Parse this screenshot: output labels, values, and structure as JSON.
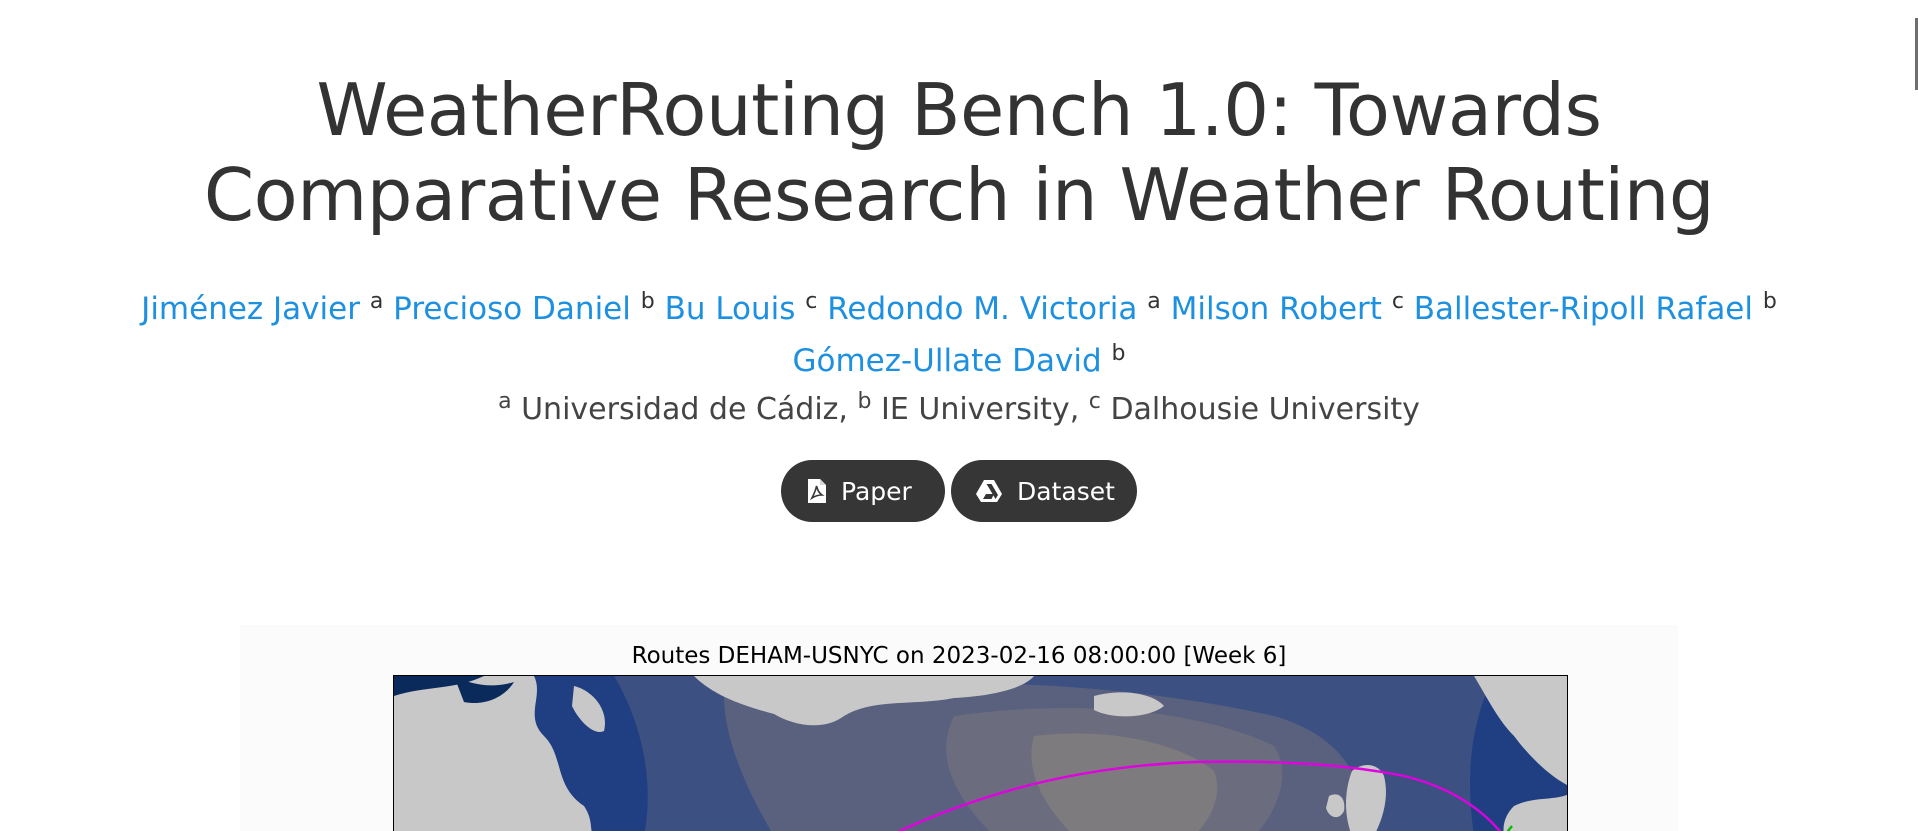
{
  "title": {
    "line1": "WeatherRouting Bench 1.0: Towards",
    "line2": "Comparative Research in Weather Routing"
  },
  "authors": [
    {
      "name": "Jiménez Javier",
      "aff": "a"
    },
    {
      "name": "Precioso Daniel",
      "aff": "b"
    },
    {
      "name": "Bu Louis",
      "aff": "c"
    },
    {
      "name": "Redondo M. Victoria",
      "aff": "a"
    },
    {
      "name": "Milson Robert",
      "aff": "c"
    },
    {
      "name": "Ballester-Ripoll Rafael",
      "aff": "b"
    },
    {
      "name": "Gómez-Ullate David",
      "aff": "b"
    }
  ],
  "affiliations": [
    {
      "mark": "a",
      "name": "Universidad de Cádiz,"
    },
    {
      "mark": "b",
      "name": "IE University,"
    },
    {
      "mark": "c",
      "name": "Dalhousie University"
    }
  ],
  "buttons": {
    "paper": {
      "label": "Paper",
      "icon": "pdf-file-icon"
    },
    "dataset": {
      "label": "Dataset",
      "icon": "google-drive-icon"
    }
  },
  "figure": {
    "title": "Routes DEHAM-USNYC on 2023-02-16 08:00:00 [Week 6]"
  },
  "colors": {
    "link": "#1e90e0",
    "text": "#333333",
    "button_bg": "#363636",
    "route_magenta": "#e000e0",
    "route_green": "#00c000",
    "land": "#c8c8c8",
    "deep_ocean": "#0a2a5e"
  }
}
